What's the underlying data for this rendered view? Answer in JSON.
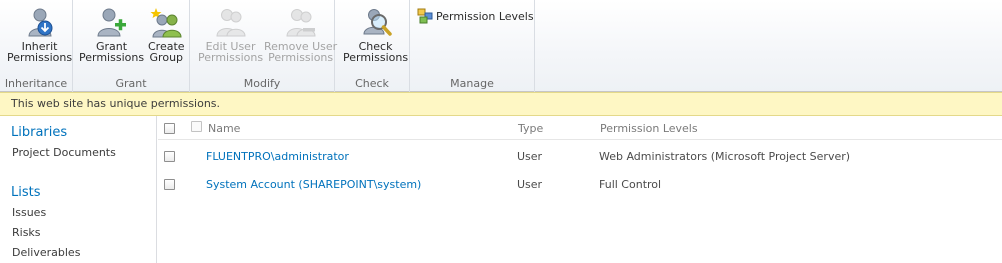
{
  "ribbon": {
    "groups": {
      "inheritance": "Inheritance",
      "grant": "Grant",
      "modify": "Modify",
      "check": "Check",
      "manage": "Manage"
    },
    "buttons": {
      "inherit_permissions": [
        "Inherit",
        "Permissions"
      ],
      "grant_permissions": [
        "Grant",
        "Permissions"
      ],
      "create_group": [
        "Create",
        "Group"
      ],
      "edit_user_permissions": [
        "Edit User",
        "Permissions"
      ],
      "remove_user_permissions": [
        "Remove User",
        "Permissions"
      ],
      "check_permissions": [
        "Check",
        "Permissions"
      ],
      "permission_levels": "Permission Levels"
    },
    "disabled_color": "#a4a4a4"
  },
  "status": {
    "message": "This web site has unique permissions.",
    "background": "#fef7c4"
  },
  "leftnav": {
    "sections": [
      {
        "heading": "Libraries",
        "items": [
          "Project Documents"
        ]
      },
      {
        "heading": "Lists",
        "items": [
          "Issues",
          "Risks",
          "Deliverables"
        ]
      }
    ],
    "heading_color": "#0072bc"
  },
  "list": {
    "columns": {
      "name": "Name",
      "type": "Type",
      "permission_levels": "Permission Levels"
    },
    "rows": [
      {
        "name": "FLUENTPRO\\administrator",
        "type": "User",
        "permission_levels": "Web Administrators (Microsoft Project Server)"
      },
      {
        "name": "System Account (SHAREPOINT\\system)",
        "type": "User",
        "permission_levels": "Full Control"
      }
    ],
    "link_color": "#0072bc"
  }
}
